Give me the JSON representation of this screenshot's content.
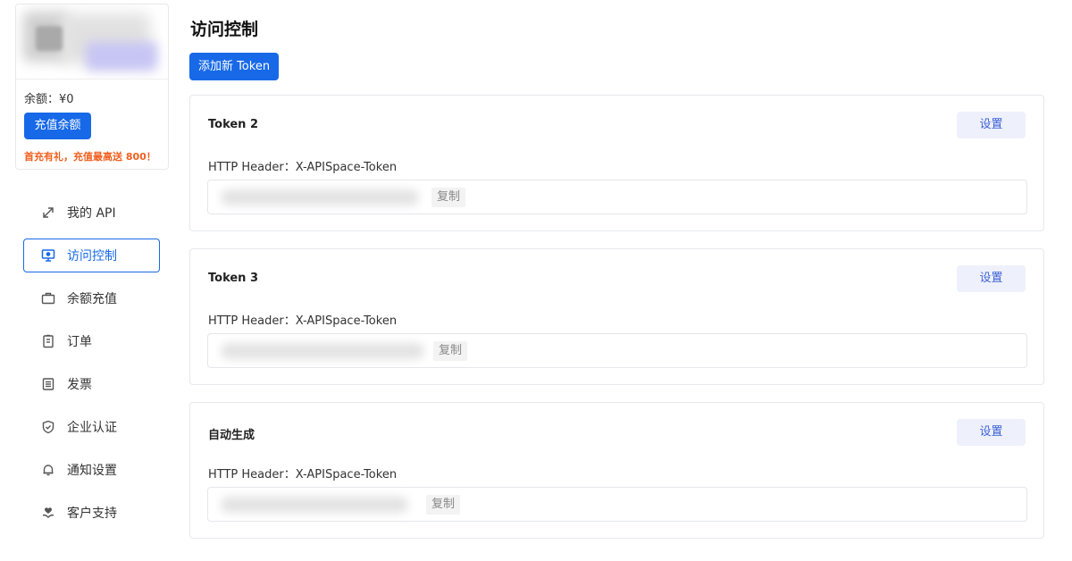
{
  "profile": {
    "balance_label": "余额：",
    "balance_value": "¥0",
    "recharge_label": "充值余额",
    "promo": "首充有礼，充值最高送 800！"
  },
  "nav": [
    {
      "label": "我的 API",
      "icon": "link-icon",
      "active": false
    },
    {
      "label": "访问控制",
      "icon": "monitor-icon",
      "active": true
    },
    {
      "label": "余额充值",
      "icon": "wallet-icon",
      "active": false
    },
    {
      "label": "订单",
      "icon": "clipboard-icon",
      "active": false
    },
    {
      "label": "发票",
      "icon": "invoice-icon",
      "active": false
    },
    {
      "label": "企业认证",
      "icon": "shield-check-icon",
      "active": false
    },
    {
      "label": "通知设置",
      "icon": "bell-icon",
      "active": false
    },
    {
      "label": "客户支持",
      "icon": "hand-heart-icon",
      "active": false
    }
  ],
  "main": {
    "title": "访问控制",
    "add_token_label": "添加新 Token",
    "tokens": [
      {
        "name": "Token 2",
        "settings_label": "设置",
        "header_text": "HTTP Header：X-APISpace-Token",
        "copy_label": "复制"
      },
      {
        "name": "Token 3",
        "settings_label": "设置",
        "header_text": "HTTP Header：X-APISpace-Token",
        "copy_label": "复制"
      },
      {
        "name": "自动生成",
        "settings_label": "设置",
        "header_text": "HTTP Header：X-APISpace-Token",
        "copy_label": "复制"
      }
    ]
  },
  "colors": {
    "primary": "#1769e8",
    "promo": "#f05f1e",
    "settings_bg": "#eef0fb",
    "settings_text": "#3d63d6"
  }
}
